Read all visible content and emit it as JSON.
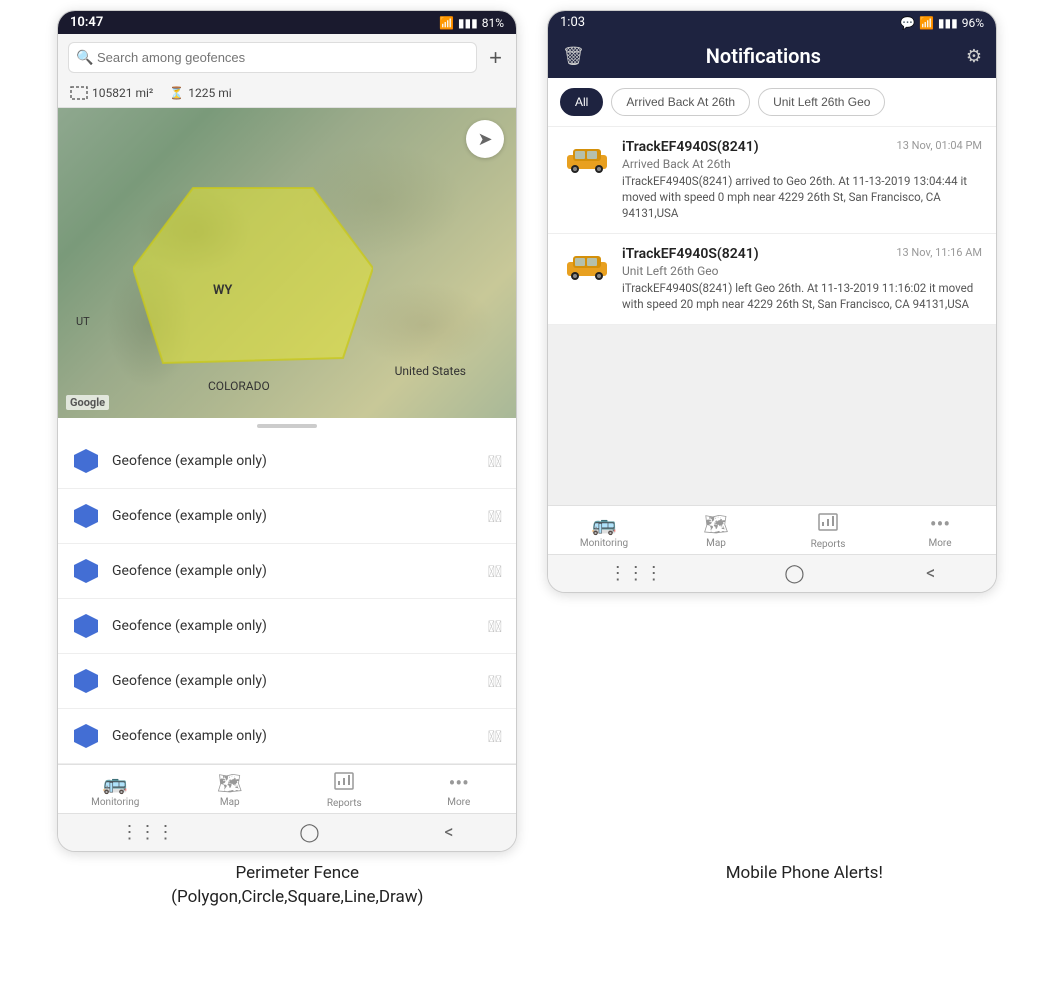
{
  "left_phone": {
    "status_bar": {
      "time": "10:47",
      "wifi": "WiFi",
      "signal": "4G",
      "battery": "81%"
    },
    "search": {
      "placeholder": "Search among geofences"
    },
    "stats": {
      "area": "105821 mi²",
      "distance": "1225 mi"
    },
    "map": {
      "label_wy": "WY",
      "label_us": "United States",
      "label_co": "COLORADO",
      "label_ut": "UT",
      "google": "Google"
    },
    "geofence_items": [
      {
        "label": "Geofence (example only)"
      },
      {
        "label": "Geofence (example only)"
      },
      {
        "label": "Geofence (example only)"
      },
      {
        "label": "Geofence (example only)"
      },
      {
        "label": "Geofence (example only)"
      },
      {
        "label": "Geofence (example only)"
      }
    ],
    "bottom_nav": [
      {
        "label": "Monitoring",
        "icon": "🚌"
      },
      {
        "label": "Map",
        "icon": "🗺"
      },
      {
        "label": "Reports",
        "icon": "📊"
      },
      {
        "label": "More",
        "icon": "···"
      }
    ]
  },
  "right_phone": {
    "status_bar": {
      "time": "1:03",
      "chat": "💬",
      "wifi": "WiFi",
      "signal": "4G",
      "battery": "96%"
    },
    "header": {
      "title": "Notifications",
      "delete_icon": "🗑",
      "settings_icon": "⚙"
    },
    "filter_tabs": [
      {
        "label": "All",
        "active": true
      },
      {
        "label": "Arrived Back At 26th",
        "active": false
      },
      {
        "label": "Unit Left 26th Geo",
        "active": false
      }
    ],
    "notifications": [
      {
        "device": "iTrackEF4940S(8241)",
        "time": "13 Nov, 01:04 PM",
        "event": "Arrived Back At 26th",
        "body": "iTrackEF4940S(8241) arrived to Geo 26th.   At 11-13-2019 13:04:44 it moved with speed 0 mph near 4229 26th St, San Francisco, CA 94131,USA"
      },
      {
        "device": "iTrackEF4940S(8241)",
        "time": "13 Nov, 11:16 AM",
        "event": "Unit Left 26th Geo",
        "body": "iTrackEF4940S(8241) left Geo 26th.   At 11-13-2019 11:16:02 it moved with speed 20 mph near 4229 26th St, San Francisco, CA 94131,USA"
      }
    ],
    "bottom_nav": [
      {
        "label": "Monitoring",
        "icon": "🚌"
      },
      {
        "label": "Map",
        "icon": "🗺"
      },
      {
        "label": "Reports",
        "icon": "📊"
      },
      {
        "label": "More",
        "icon": "···"
      }
    ]
  },
  "captions": {
    "left": "Perimeter Fence\n(Polygon,Circle,Square,Line,Draw)",
    "right": "Mobile Phone Alerts!"
  }
}
